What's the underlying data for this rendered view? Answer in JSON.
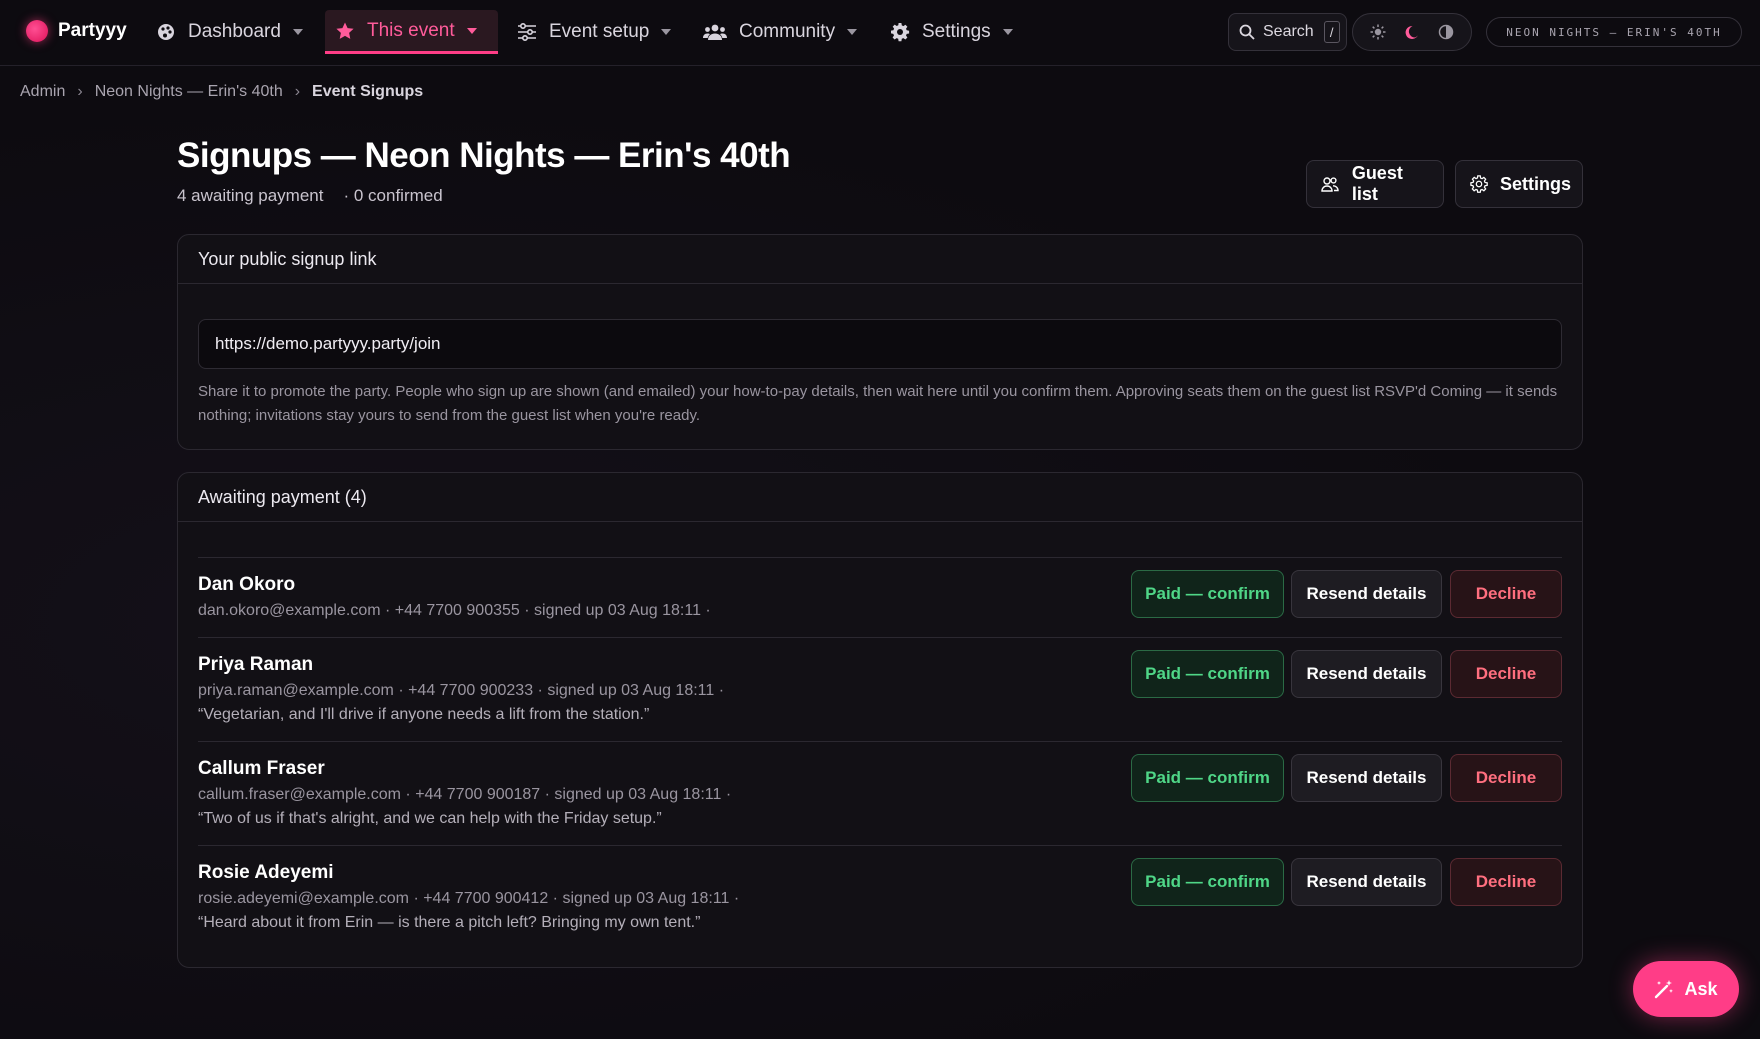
{
  "nav": {
    "brand": "Partyyy",
    "items": [
      {
        "label": "Dashboard",
        "icon": "palette-icon"
      },
      {
        "label": "This event",
        "icon": "star-icon",
        "active": true
      },
      {
        "label": "Event setup",
        "icon": "sliders-icon"
      },
      {
        "label": "Community",
        "icon": "users-icon"
      },
      {
        "label": "Settings",
        "icon": "gear-icon"
      }
    ],
    "search_label": "Search",
    "search_shortcut": "/",
    "event_pill": "NEON NIGHTS — ERIN'S 40TH"
  },
  "breadcrumb": [
    "Admin",
    "Neon Nights — Erin's 40th",
    "Event Signups"
  ],
  "header": {
    "title": "Signups — Neon Nights — Erin's 40th",
    "awaiting": "4 awaiting payment",
    "confirmed": "· 0 confirmed",
    "guest_list_label": "Guest list",
    "settings_label": "Settings"
  },
  "signup_link": {
    "heading": "Your public signup link",
    "url": "https://demo.partyyy.party/join",
    "helper": "Share it to promote the party. People who sign up are shown (and emailed) your how-to-pay details, then wait here until you confirm them. Approving seats them on the guest list RSVP'd Coming — it sends nothing; invitations stay yours to send from the guest list when you're ready."
  },
  "awaiting": {
    "heading": "Awaiting payment (4)",
    "confirm_label": "Paid — confirm",
    "resend_label": "Resend details",
    "decline_label": "Decline",
    "rows": [
      {
        "name": "Dan Okoro",
        "meta": "dan.okoro@example.com · +44 7700 900355 · signed up 03 Aug 18:11 ·",
        "note": ""
      },
      {
        "name": "Priya Raman",
        "meta": "priya.raman@example.com · +44 7700 900233 · signed up 03 Aug 18:11 ·",
        "note": "“Vegetarian, and I'll drive if anyone needs a lift from the station.”"
      },
      {
        "name": "Callum Fraser",
        "meta": "callum.fraser@example.com · +44 7700 900187 · signed up 03 Aug 18:11 ·",
        "note": "“Two of us if that's alright, and we can help with the Friday setup.”"
      },
      {
        "name": "Rosie Adeyemi",
        "meta": "rosie.adeyemi@example.com · +44 7700 900412 · signed up 03 Aug 18:11 ·",
        "note": "“Heard about it from Erin — is there a pitch left? Bringing my own tent.”"
      }
    ]
  },
  "ask_label": "Ask",
  "colors": {
    "accent": "#ff3d87",
    "confirm": "#4fd687",
    "decline": "#ff6f7f"
  }
}
